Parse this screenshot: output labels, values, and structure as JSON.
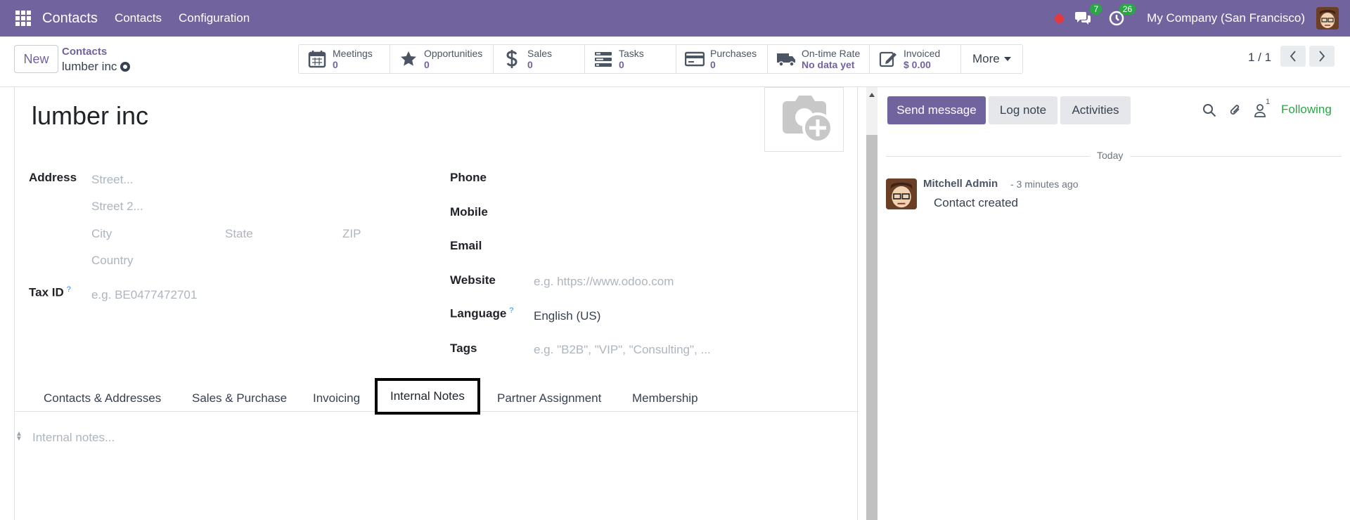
{
  "navbar": {
    "brand": "Contacts",
    "menu": [
      "Contacts",
      "Configuration"
    ],
    "messages_count": "7",
    "activities_count": "26",
    "company": "My Company (San Francisco)"
  },
  "control": {
    "new_label": "New",
    "breadcrumb_parent": "Contacts",
    "breadcrumb_current": "lumber inc",
    "smart_buttons": [
      {
        "label": "Meetings",
        "value": "0",
        "icon": "calendar-icon"
      },
      {
        "label": "Opportunities",
        "value": "0",
        "icon": "star-icon"
      },
      {
        "label": "Sales",
        "value": "0",
        "icon": "dollar-icon"
      },
      {
        "label": "Tasks",
        "value": "0",
        "icon": "tasks-icon"
      },
      {
        "label": "Purchases",
        "value": "0",
        "icon": "credit-card-icon"
      },
      {
        "label": "On-time Rate",
        "value": "No data yet",
        "icon": "truck-icon"
      },
      {
        "label": "Invoiced",
        "value": "$ 0.00",
        "icon": "edit-icon"
      }
    ],
    "more_label": "More",
    "pager": "1 / 1"
  },
  "form": {
    "name": "lumber inc",
    "address_label": "Address",
    "street_ph": "Street...",
    "street2_ph": "Street 2...",
    "city_ph": "City",
    "state_ph": "State",
    "zip_ph": "ZIP",
    "country_ph": "Country",
    "taxid_label": "Tax ID",
    "taxid_help": "?",
    "taxid_ph": "e.g. BE0477472701",
    "phone_label": "Phone",
    "mobile_label": "Mobile",
    "email_label": "Email",
    "website_label": "Website",
    "website_ph": "e.g. https://www.odoo.com",
    "language_label": "Language",
    "language_help": "?",
    "language_value": "English (US)",
    "tags_label": "Tags",
    "tags_ph": "e.g. \"B2B\", \"VIP\", \"Consulting\", ...",
    "tabs": [
      "Contacts & Addresses",
      "Sales & Purchase",
      "Invoicing",
      "Internal Notes",
      "Partner Assignment",
      "Membership"
    ],
    "active_tab": "Internal Notes",
    "notes_ph": "Internal notes..."
  },
  "chatter": {
    "send_message": "Send message",
    "log_note": "Log note",
    "activities": "Activities",
    "followers_count": "1",
    "following": "Following",
    "date_separator": "Today",
    "messages": [
      {
        "author": "Mitchell Admin",
        "time": "- 3 minutes ago",
        "body": "Contact created"
      }
    ]
  },
  "colors": {
    "brand": "#71639e",
    "success": "#28a745",
    "record": "#e0393e"
  }
}
